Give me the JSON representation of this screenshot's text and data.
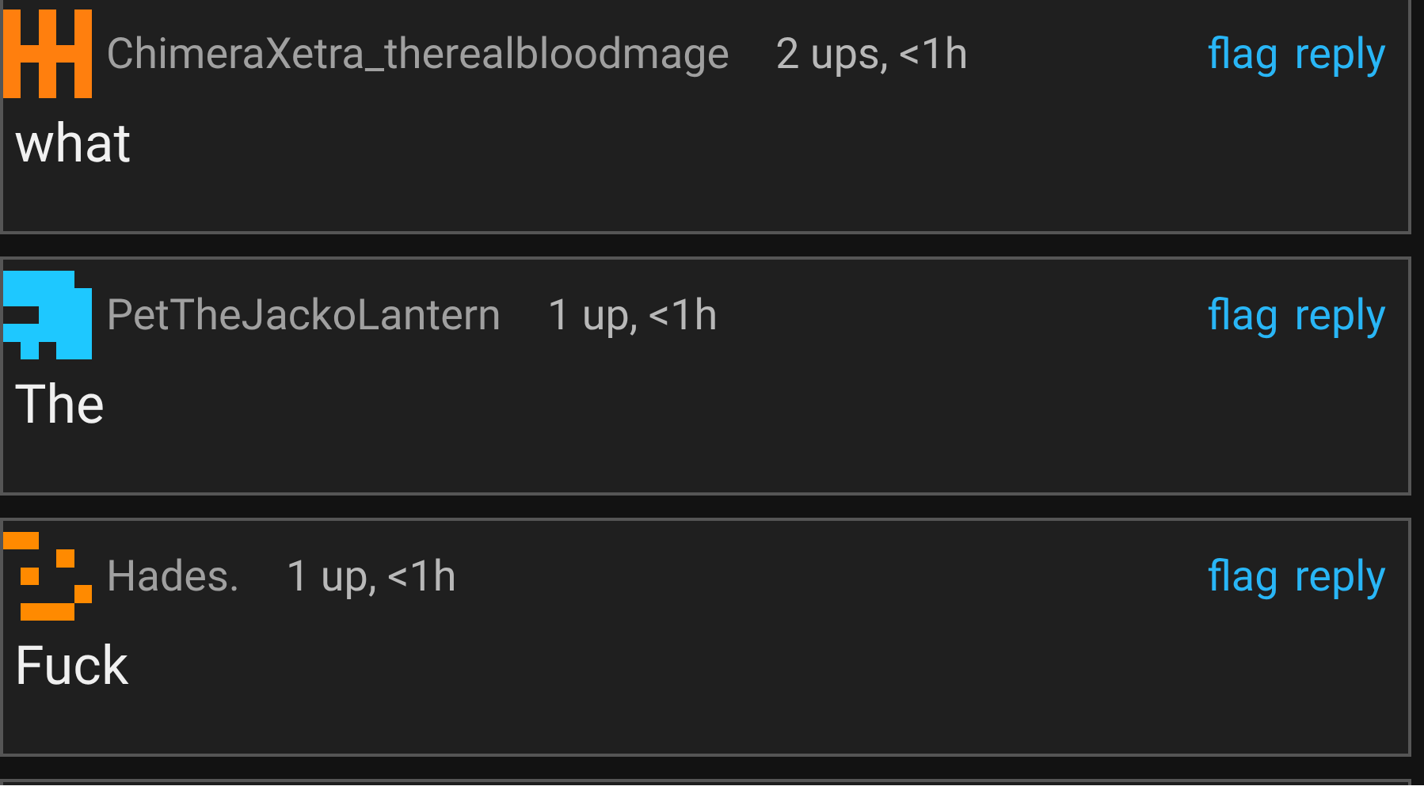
{
  "comments": [
    {
      "author": "ChimeraXetra_therealbloodmage",
      "avatar": {
        "color": "#ff7f0e"
      },
      "score": "2 ups, <1h",
      "actions": [
        "flag",
        "reply"
      ],
      "body": "what"
    },
    {
      "author": "PetTheJackoLantern",
      "avatar": {
        "color": "#1ec8ff"
      },
      "score": "1 up, <1h",
      "actions": [
        "flag",
        "reply"
      ],
      "body": "The"
    },
    {
      "author": "Hades.",
      "avatar": {
        "color": "#ff8a00"
      },
      "score": "1 up, <1h",
      "actions": [
        "flag",
        "reply"
      ],
      "body": "Fuck"
    }
  ]
}
